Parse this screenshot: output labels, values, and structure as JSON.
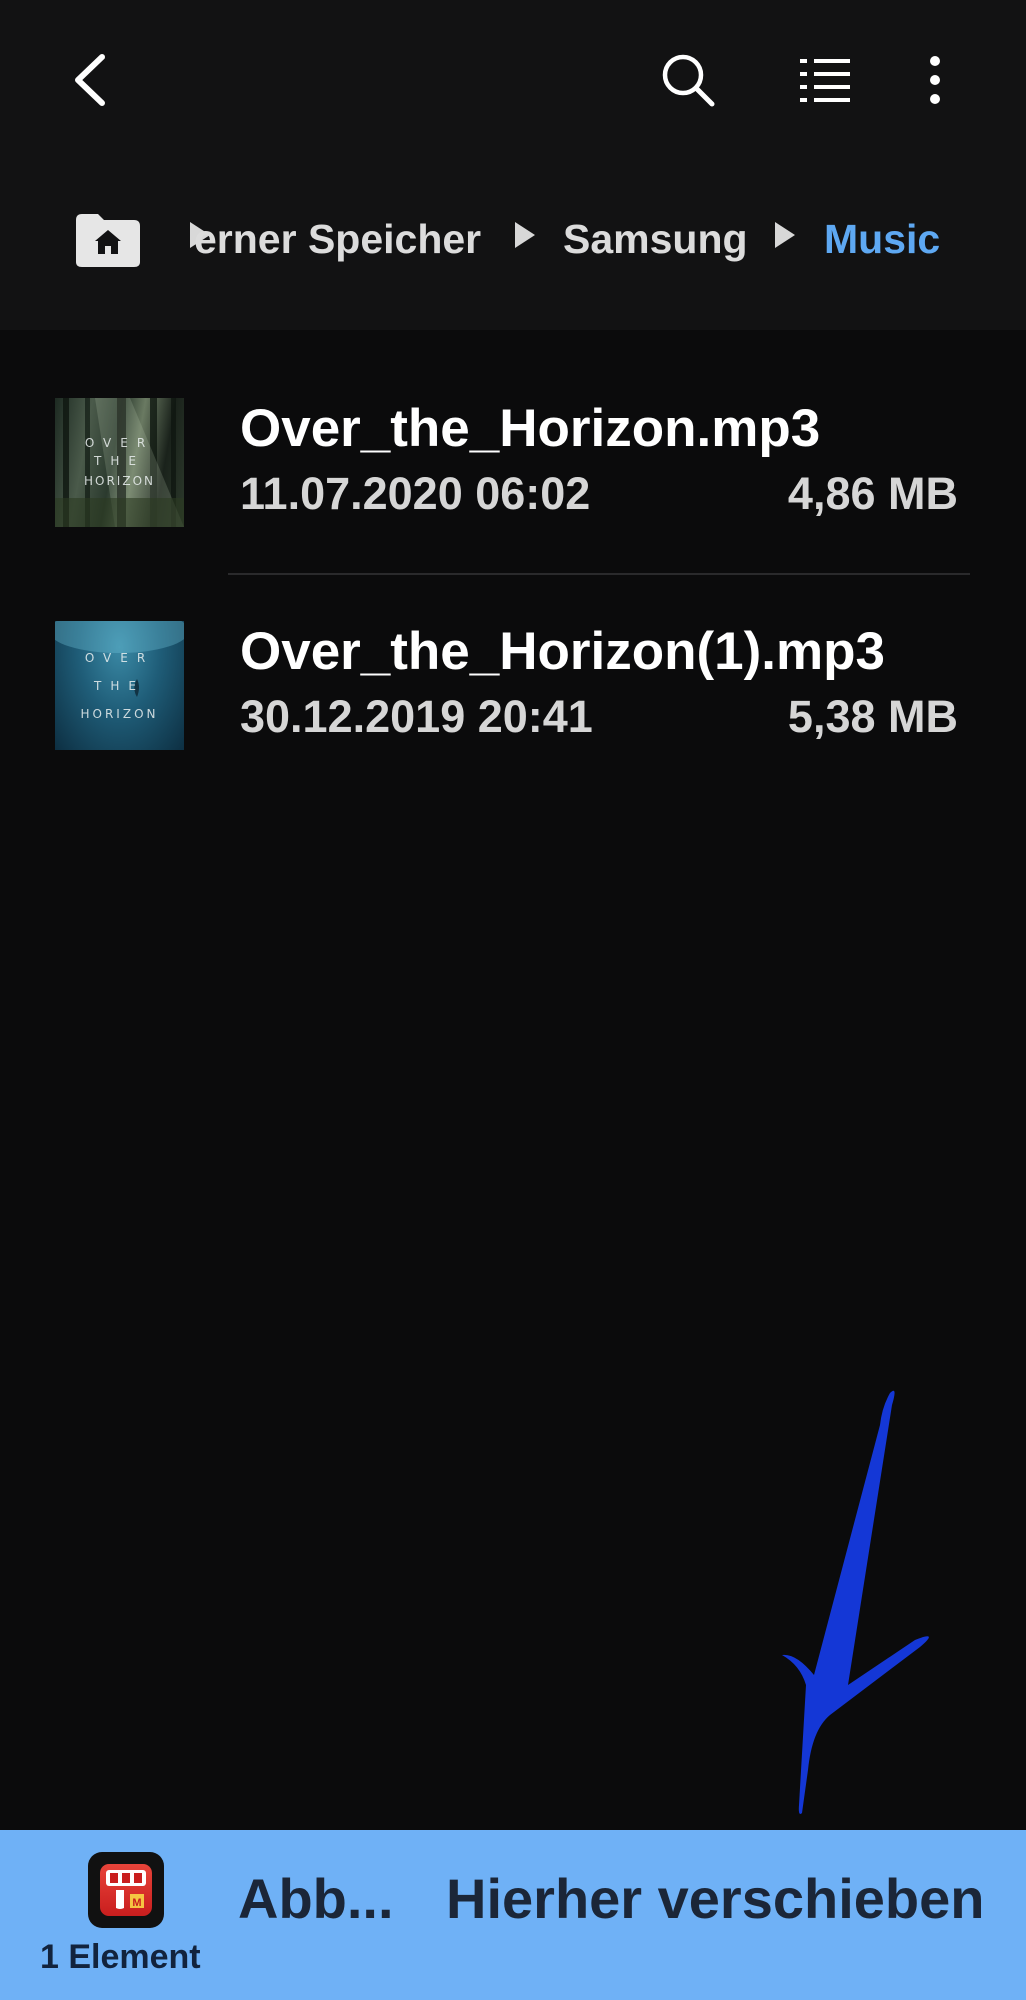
{
  "header": {
    "icons": [
      "back-icon",
      "search-icon",
      "list-view-icon",
      "more-options-icon"
    ]
  },
  "breadcrumb": {
    "home_icon": "home-folder-icon",
    "items": [
      {
        "label": "erner Speicher"
      },
      {
        "label": "Samsung"
      },
      {
        "label": "Music"
      }
    ],
    "active_color": "#5ea8f2"
  },
  "files": [
    {
      "name": "Over_the_Horizon.mp3",
      "date": "11.07.2020 06:02",
      "size": "4,86 MB",
      "thumb_text": [
        "OVER",
        "THE",
        "HORIZON"
      ]
    },
    {
      "name": "Over_the_Horizon(1).mp3",
      "date": "30.12.2019 20:41",
      "size": "5,38 MB",
      "thumb_text": [
        "OVER",
        "THE",
        "HORIZON"
      ]
    }
  ],
  "bottombar": {
    "app_icon": "tubemate-app-icon",
    "element_count": "1 Element",
    "cancel_label": "Abb...",
    "move_label": "Hierher verschieben",
    "background": "#6fb1f6"
  },
  "annotation": {
    "icon": "handwritten-check-mark",
    "color": "#1437d6"
  }
}
